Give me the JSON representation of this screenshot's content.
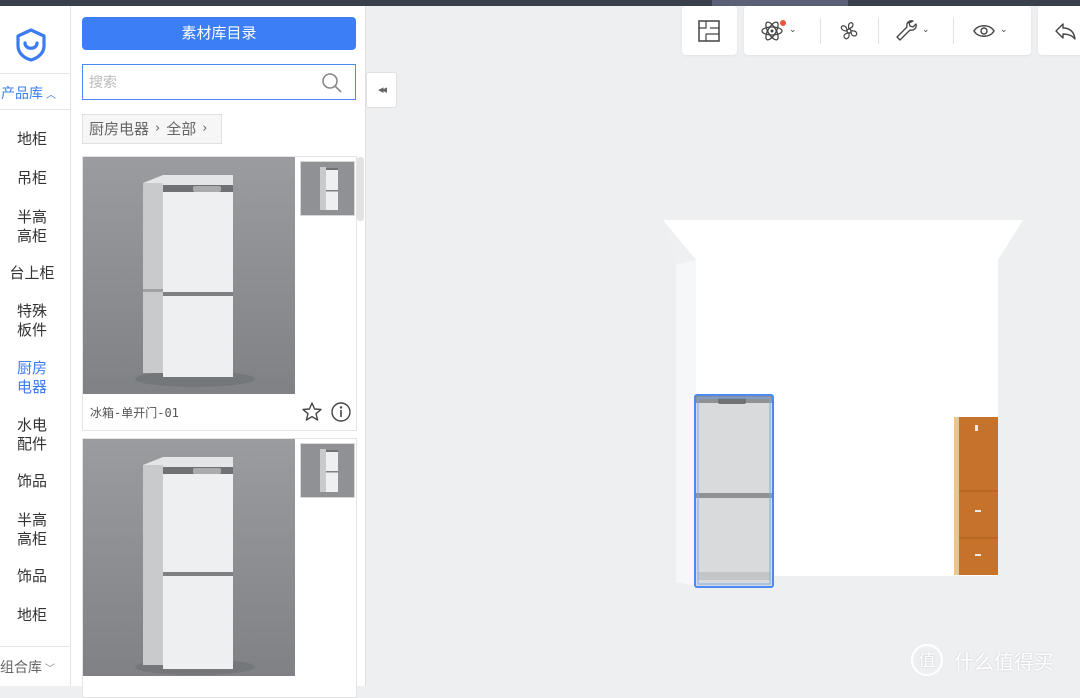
{
  "rail": {
    "product_lib": "产品库",
    "categories": [
      "地柜",
      "吊柜",
      "半高\n高柜",
      "台上柜",
      "特殊\n板件",
      "厨房\n电器",
      "水电\n配件",
      "饰品",
      "半高\n高柜",
      "饰品",
      "地柜"
    ],
    "active_index": 5,
    "combo_lib": "组合库"
  },
  "panel": {
    "catalog_button": "素材库目录",
    "search_placeholder": "搜索",
    "breadcrumb": [
      "厨房电器",
      "全部"
    ],
    "products": [
      {
        "name": "冰箱-单开门-01"
      },
      {
        "name": ""
      }
    ]
  },
  "toolbar": {
    "icons": [
      "floorplan-icon",
      "atom-icon",
      "fan-icon",
      "wrench-icon",
      "eye-icon",
      "undo-icon"
    ]
  },
  "watermark": {
    "text": "什么值得买"
  },
  "colors": {
    "accent": "#3b7cf3",
    "button": "#3b7ef5",
    "selection": "#4a8af4",
    "cabinet_wood": "#c7722a"
  }
}
